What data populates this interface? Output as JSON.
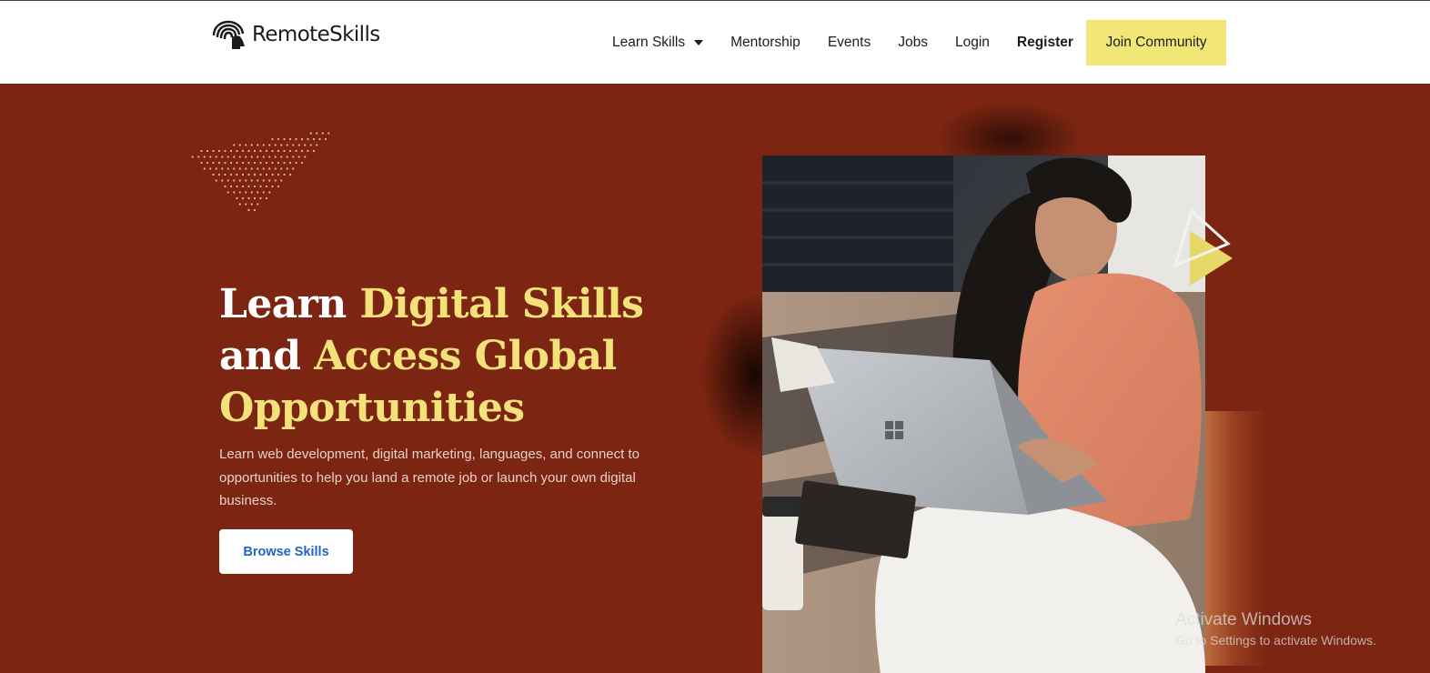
{
  "brand": {
    "name": "RemoteSkills",
    "logo_icon": "fingerprint-head-icon"
  },
  "nav": {
    "items": [
      {
        "label": "Learn Skills",
        "has_dropdown": true
      },
      {
        "label": "Mentorship"
      },
      {
        "label": "Events"
      },
      {
        "label": "Jobs"
      },
      {
        "label": "Login"
      },
      {
        "label": "Register",
        "bold": true
      }
    ],
    "cta_label": "Join Community"
  },
  "hero": {
    "title_part1": "Learn ",
    "title_hl1": "Digital Skills",
    "title_part2": "and ",
    "title_hl2": "Access Global",
    "title_hl3": "Opportunities",
    "subtitle": "Learn web development, digital marketing, languages, and connect to opportunities to help you land a remote job or launch your own digital business.",
    "button_label": "Browse Skills",
    "image_description_icon": "woman-laptop-photo"
  },
  "os_watermark": {
    "title": "Activate Windows",
    "subtitle": "Go to Settings to activate Windows."
  },
  "colors": {
    "hero_bg": "#7b2512",
    "highlight": "#f3e27a",
    "cta_bg": "#f2e676",
    "button_text": "#2164c8"
  }
}
